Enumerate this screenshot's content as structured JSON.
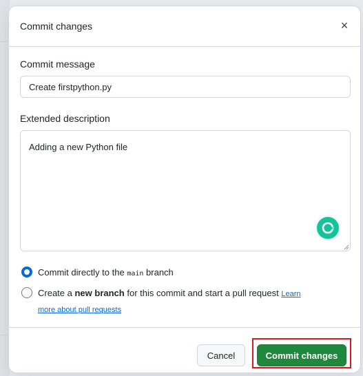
{
  "dialog": {
    "title": "Commit changes",
    "close_icon": "close-icon",
    "close_glyph": "×"
  },
  "commit_message": {
    "label": "Commit message",
    "value": "Create firstpython.py"
  },
  "extended_description": {
    "label": "Extended description",
    "value": "Adding a new Python file"
  },
  "branch_options": {
    "direct": {
      "text_before": "Commit directly to the ",
      "branch": "main",
      "text_after": " branch",
      "checked": true
    },
    "new_branch": {
      "text_before": "Create a ",
      "bold": "new branch",
      "text_after": " for this commit and start a pull request ",
      "link_line1": "Learn",
      "link_line2": "more about pull requests",
      "checked": false
    }
  },
  "footer": {
    "cancel_label": "Cancel",
    "commit_label": "Commit changes"
  },
  "colors": {
    "primary_green": "#1f883d",
    "accent_blue": "#0969da",
    "highlight_red": "#d7191c",
    "grammarly_green": "#15c39a"
  }
}
